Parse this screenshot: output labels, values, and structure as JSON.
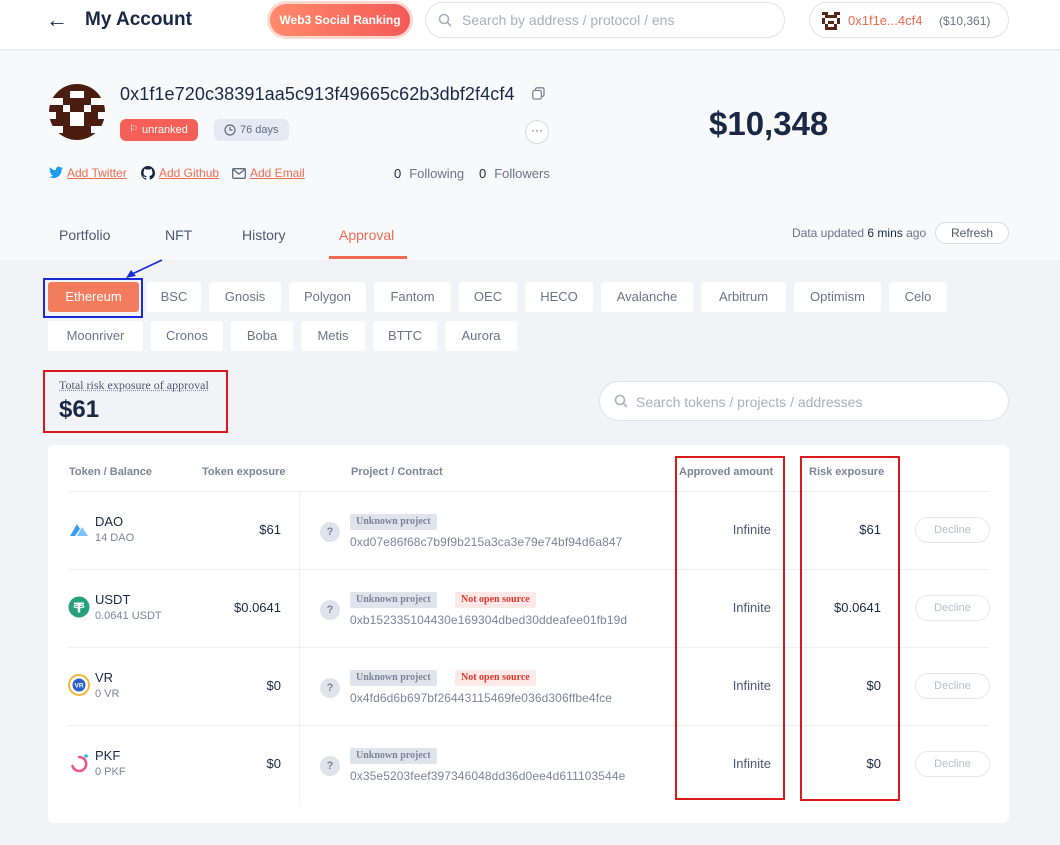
{
  "header": {
    "title": "My Account",
    "web3_button": "Web3 Social Ranking",
    "search_placeholder": "Search by address / protocol / ens",
    "account_short": "0x1f1e...4cf4",
    "account_balance": "($10,361)"
  },
  "profile": {
    "address": "0x1f1e720c38391aa5c913f49665c62b3dbf2f4cf4",
    "rank_badge": "unranked",
    "days_badge": "76 days",
    "more_label": "···",
    "total_value": "$10,348",
    "add_twitter": "Add Twitter",
    "add_github": "Add Github",
    "add_email": "Add Email",
    "following_count": "0",
    "following_label": "Following",
    "followers_count": "0",
    "followers_label": "Followers"
  },
  "tabs": [
    {
      "label": "Portfolio",
      "active": false
    },
    {
      "label": "NFT",
      "active": false
    },
    {
      "label": "History",
      "active": false
    },
    {
      "label": "Approval",
      "active": true
    }
  ],
  "update": {
    "prefix": "Data updated",
    "time": "6 mins",
    "suffix": "ago",
    "refresh": "Refresh"
  },
  "chains": {
    "selected": "Ethereum",
    "items": [
      "Ethereum",
      "BSC",
      "Gnosis",
      "Polygon",
      "Fantom",
      "OEC",
      "HECO",
      "Avalanche",
      "Arbitrum",
      "Optimism",
      "Celo",
      "Moonriver",
      "Cronos",
      "Boba",
      "Metis",
      "BTTC",
      "Aurora"
    ]
  },
  "exposure": {
    "label": "Total risk exposure of approval",
    "value": "$61",
    "search_placeholder": "Search tokens / projects / addresses"
  },
  "table": {
    "headers": {
      "token": "Token / Balance",
      "token_exposure": "Token exposure",
      "project": "Project / Contract",
      "approved": "Approved amount",
      "risk": "Risk exposure"
    },
    "rows": [
      {
        "icon": "dao-icon",
        "token": "DAO",
        "balance": "14 DAO",
        "exposure": "$61",
        "project": "Unknown project",
        "warning": "",
        "contract": "0xd07e86f68c7b9f9b215a3ca3e79e74bf94d6a847",
        "approved": "Infinite",
        "risk": "$61",
        "action": "Decline"
      },
      {
        "icon": "usdt-icon",
        "token": "USDT",
        "balance": "0.0641 USDT",
        "exposure": "$0.0641",
        "project": "Unknown project",
        "warning": "Not open source",
        "contract": "0xb152335104430e169304dbed30ddeafee01fb19d",
        "approved": "Infinite",
        "risk": "$0.0641",
        "action": "Decline"
      },
      {
        "icon": "vr-icon",
        "token": "VR",
        "balance": "0 VR",
        "exposure": "$0",
        "project": "Unknown project",
        "warning": "Not open source",
        "contract": "0x4fd6d6b697bf26443115469fe036d306ffbe4fce",
        "approved": "Infinite",
        "risk": "$0",
        "action": "Decline"
      },
      {
        "icon": "pkf-icon",
        "token": "PKF",
        "balance": "0 PKF",
        "exposure": "$0",
        "project": "Unknown project",
        "warning": "",
        "contract": "0x35e5203feef397346048dd36d0ee4d611103544e",
        "approved": "Infinite",
        "risk": "$0",
        "action": "Decline"
      }
    ]
  },
  "colors": {
    "accent": "#f06a50",
    "annotation_red": "#d8191e",
    "annotation_blue": "#1a2bd6"
  }
}
